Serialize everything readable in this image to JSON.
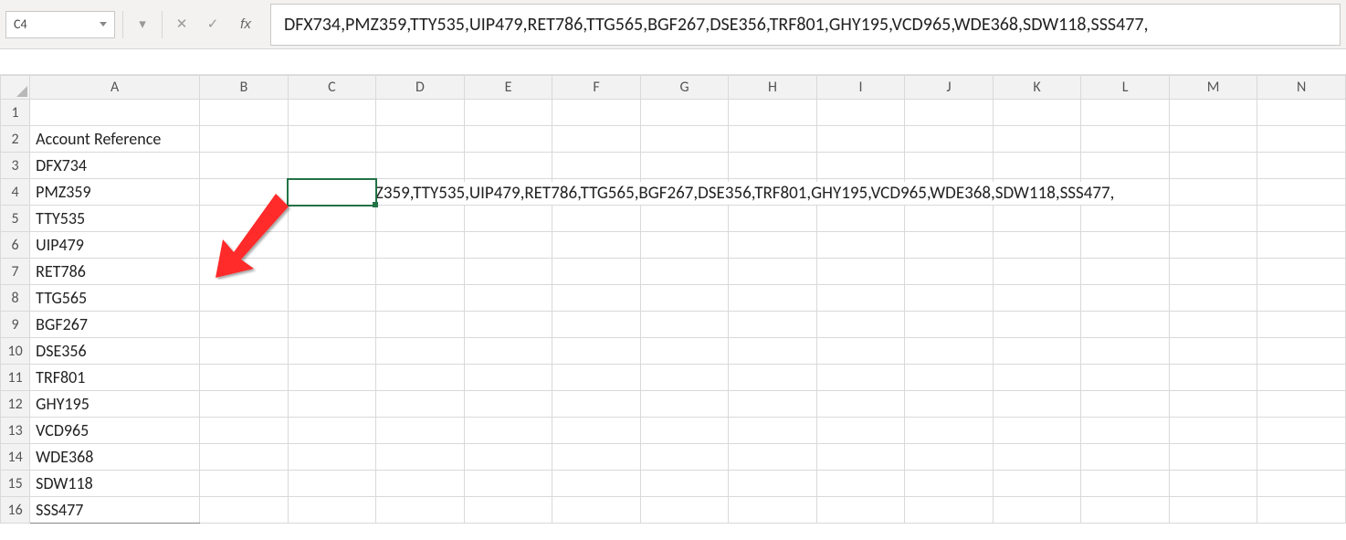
{
  "name_box": "C4",
  "formula_text": "DFX734,PMZ359,TTY535,UIP479,RET786,TTG565,BGF267,DSE356,TRF801,GHY195,VCD965,WDE368,SDW118,SSS477,",
  "icons": {
    "cancel": "✕",
    "enter": "✓",
    "expand": "▾"
  },
  "fx_label": "fx",
  "columns": [
    "A",
    "B",
    "C",
    "D",
    "E",
    "F",
    "G",
    "H",
    "I",
    "J",
    "K",
    "L",
    "M",
    "N"
  ],
  "row_count": 16,
  "sheet": {
    "header_label": "Account Reference",
    "values": [
      "DFX734",
      "PMZ359",
      "TTY535",
      "UIP479",
      "RET786",
      "TTG565",
      "BGF267",
      "DSE356",
      "TRF801",
      "GHY195",
      "VCD965",
      "WDE368",
      "SDW118",
      "SSS477"
    ],
    "c4_value": "DFX734,PMZ359,TTY535,UIP479,RET786,TTG565,BGF267,DSE356,TRF801,GHY195,VCD965,WDE368,SDW118,SSS477,"
  }
}
